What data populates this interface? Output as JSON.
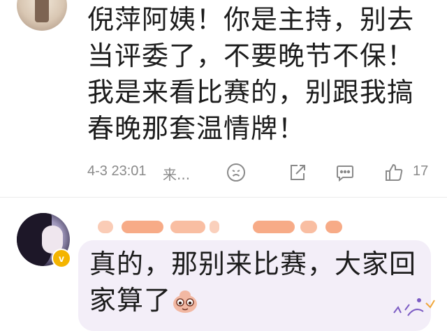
{
  "comment1": {
    "text": "倪萍阿姨！你是主持，别去当评委了，不要晚节不保！我是来看比赛的，别跟我搞春晚那套温情牌！",
    "time": "4-3 23:01",
    "more": "来...",
    "like_count": "17",
    "icons": [
      "emoji-icon",
      "share-icon",
      "reply-icon",
      "like-icon"
    ]
  },
  "comment2": {
    "badge": "v",
    "text": "真的，那别来比赛，大家回家算了",
    "sticker": "peeking-emoji-sticker"
  },
  "colors": {
    "text": "#1c1c1c",
    "meta": "#8a8a8a",
    "bubble": "#f3eef8",
    "badge": "#f4b400"
  }
}
